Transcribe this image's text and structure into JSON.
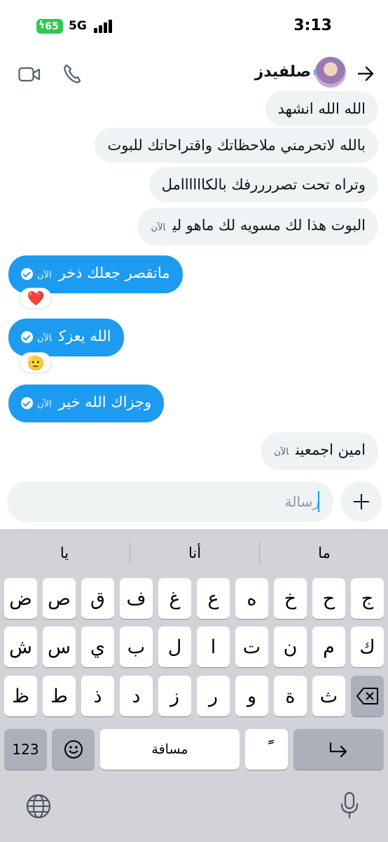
{
  "status_bar": {
    "battery": "65",
    "network": "5G",
    "time": "3:13"
  },
  "header": {
    "contact_name": "صلفيدز",
    "icons": [
      "video-icon",
      "phone-icon",
      "verified-icon",
      "back-arrow-icon"
    ]
  },
  "messages": [
    {
      "direction": "incoming",
      "text": "الله الله انشهد",
      "time": ""
    },
    {
      "direction": "incoming",
      "text": "بالله لاتحرمني ملاحظاتك واقتراحاتك للبوت",
      "time": ""
    },
    {
      "direction": "incoming",
      "text": "وتراه تحت تصررررفك بالكاااااامل",
      "time": ""
    },
    {
      "direction": "incoming",
      "text": "البوت هذا لك مسويه لك ماهو لي",
      "time": "الآن"
    },
    {
      "direction": "outgoing",
      "text": "ماتقصر جعلك ذخر",
      "time": "الآن",
      "reaction": "❤️"
    },
    {
      "direction": "outgoing",
      "text": "الله يعزك",
      "time": "الآن",
      "reaction": "🫡"
    },
    {
      "direction": "outgoing",
      "text": "وجزاك الله خير",
      "time": "الآن"
    },
    {
      "direction": "incoming",
      "text": "امين اجمعين",
      "time": "الآن"
    }
  ],
  "composer": {
    "placeholder": "رسالة"
  },
  "keyboard": {
    "suggestions": [
      "يا",
      "أنا",
      "ما"
    ],
    "row1": [
      "ض",
      "ص",
      "ق",
      "ف",
      "غ",
      "ع",
      "ه",
      "خ",
      "ح",
      "ج"
    ],
    "row2": [
      "ش",
      "س",
      "ي",
      "ب",
      "ل",
      "ا",
      "ت",
      "ن",
      "م",
      "ك"
    ],
    "row3": [
      "ظ",
      "ط",
      "ذ",
      "د",
      "ز",
      "ر",
      "و",
      "ة",
      "ث"
    ],
    "numbers_label": "123",
    "space_label": "مسافة",
    "diacritic_label": "ًً",
    "icons": [
      "emoji-icon",
      "return-icon",
      "delete-icon",
      "globe-icon",
      "mic-icon"
    ]
  },
  "colors": {
    "accent": "#1d9bf0",
    "incoming_bubble": "#eff3f4",
    "keyboard_bg": "#d1d3d9"
  }
}
